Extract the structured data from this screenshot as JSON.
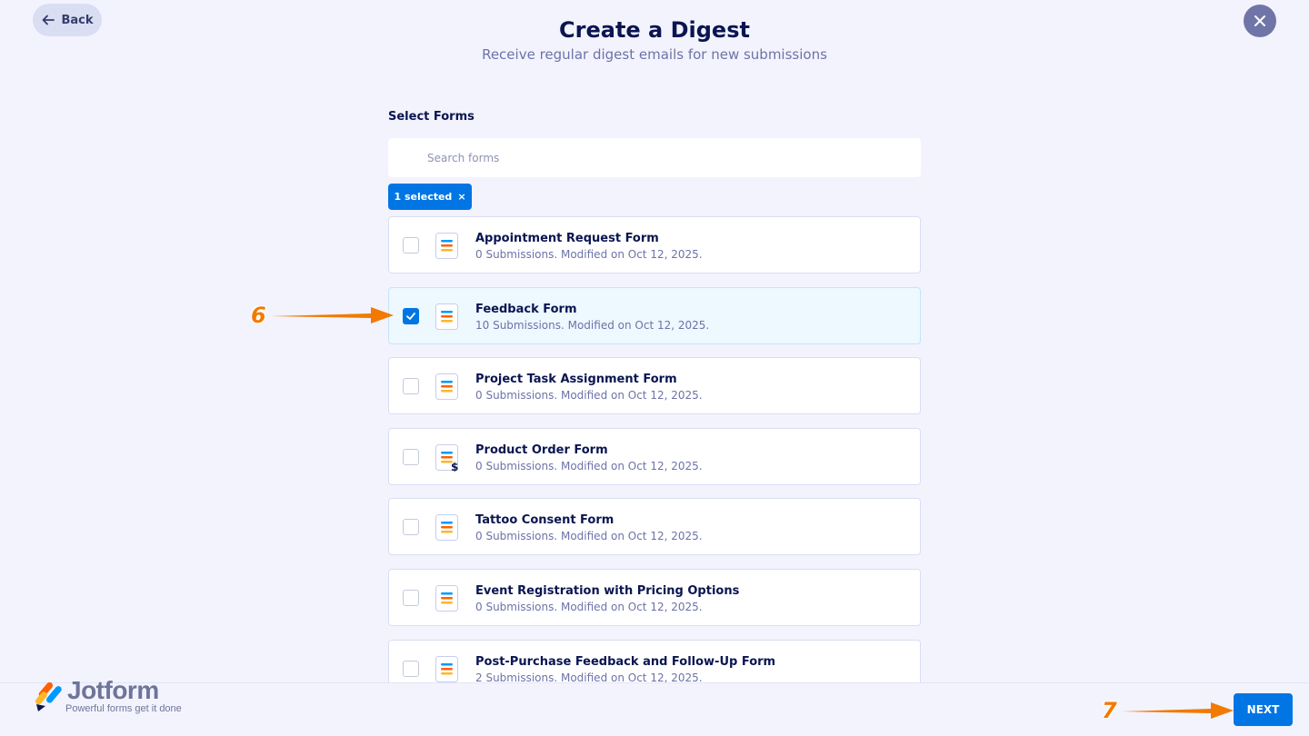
{
  "nav": {
    "back_label": "Back"
  },
  "header": {
    "title": "Create a Digest",
    "subtitle": "Receive regular digest emails for new submissions"
  },
  "select_forms": {
    "label": "Select Forms",
    "search_placeholder": "Search forms",
    "selected_chip": "1 selected"
  },
  "forms": [
    {
      "title": "Appointment Request Form",
      "meta": "0 Submissions. Modified on Oct 12, 2025.",
      "checked": false,
      "icon": "form-icon"
    },
    {
      "title": "Feedback Form",
      "meta": "10 Submissions. Modified on Oct 12, 2025.",
      "checked": true,
      "icon": "form-icon"
    },
    {
      "title": "Project Task Assignment Form",
      "meta": "0 Submissions. Modified on Oct 12, 2025.",
      "checked": false,
      "icon": "form-icon"
    },
    {
      "title": "Product Order Form",
      "meta": "0 Submissions. Modified on Oct 12, 2025.",
      "checked": false,
      "icon": "payment-form-icon"
    },
    {
      "title": "Tattoo Consent Form",
      "meta": "0 Submissions. Modified on Oct 12, 2025.",
      "checked": false,
      "icon": "form-icon"
    },
    {
      "title": "Event Registration with Pricing Options",
      "meta": "0 Submissions. Modified on Oct 12, 2025.",
      "checked": false,
      "icon": "form-icon"
    },
    {
      "title": "Post-Purchase Feedback and Follow-Up Form",
      "meta": "2 Submissions. Modified on Oct 12, 2025.",
      "checked": false,
      "icon": "form-icon"
    }
  ],
  "footer": {
    "logo_name": "Jotform",
    "logo_tagline": "Powerful forms get it done",
    "next_label": "NEXT"
  },
  "annotations": {
    "step_6": "6",
    "step_7": "7"
  },
  "colors": {
    "accent": "#0075e3",
    "background": "#f3f3fe",
    "title": "#0a1551",
    "annotation": "#f27a00"
  }
}
